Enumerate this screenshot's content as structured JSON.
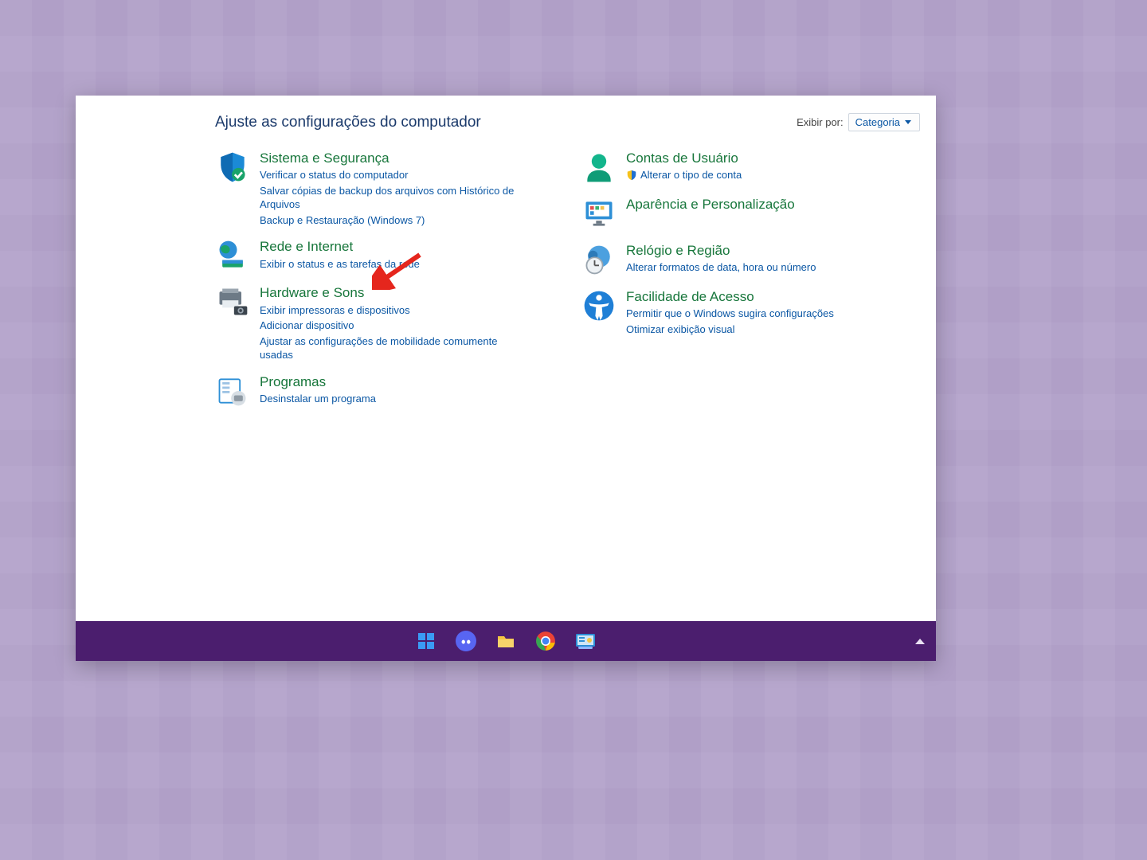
{
  "page": {
    "heading": "Ajuste as configurações do computador",
    "viewby_label": "Exibir por:",
    "viewby_value": "Categoria"
  },
  "left_categories": [
    {
      "id": "system-security",
      "title": "Sistema e Segurança",
      "links": [
        "Verificar o status do computador",
        "Salvar cópias de backup dos arquivos com Histórico de Arquivos",
        "Backup e Restauração (Windows 7)"
      ]
    },
    {
      "id": "network-internet",
      "title": "Rede e Internet",
      "links": [
        "Exibir o status e as tarefas da rede"
      ]
    },
    {
      "id": "hardware-sound",
      "title": "Hardware e Sons",
      "links": [
        "Exibir impressoras e dispositivos",
        "Adicionar dispositivo",
        "Ajustar as configurações de mobilidade comumente usadas"
      ]
    },
    {
      "id": "programs",
      "title": "Programas",
      "links": [
        "Desinstalar um programa"
      ]
    }
  ],
  "right_categories": [
    {
      "id": "user-accounts",
      "title": "Contas de Usuário",
      "links": [
        {
          "text": "Alterar o tipo de conta",
          "shield": true
        }
      ]
    },
    {
      "id": "appearance",
      "title": "Aparência e Personalização",
      "links": []
    },
    {
      "id": "clock-region",
      "title": "Relógio e Região",
      "links": [
        "Alterar formatos de data, hora ou número"
      ]
    },
    {
      "id": "ease-of-access",
      "title": "Facilidade de Acesso",
      "links": [
        "Permitir que o Windows sugira configurações",
        "Otimizar exibição visual"
      ]
    }
  ],
  "annotation": {
    "target": "hardware-sound",
    "color": "#e5261d"
  },
  "taskbar": {
    "items": [
      "start",
      "discord",
      "file-explorer",
      "chrome",
      "control-panel"
    ],
    "active": "control-panel"
  }
}
